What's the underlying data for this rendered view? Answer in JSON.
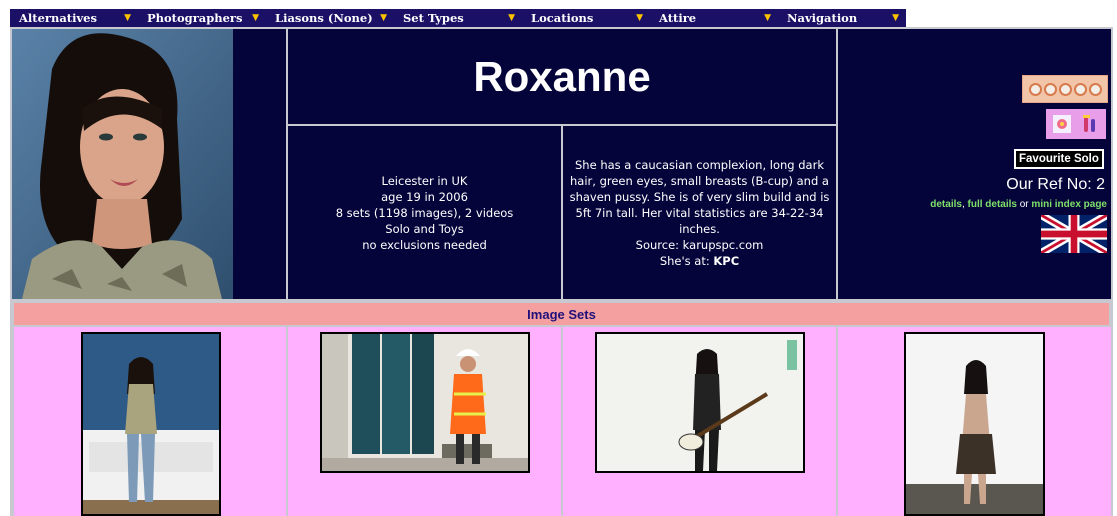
{
  "nav": [
    {
      "label": "Alternatives"
    },
    {
      "label": "Photographers"
    },
    {
      "label": "Liasons (None)"
    },
    {
      "label": "Set Types"
    },
    {
      "label": "Locations"
    },
    {
      "label": "Attire"
    },
    {
      "label": "Navigation"
    }
  ],
  "nav_arrow": "▼",
  "model": {
    "name": "Roxanne",
    "info": [
      "Leicester in UK",
      "age 19 in 2006",
      "8 sets (1198 images), 2 videos",
      "Solo and Toys",
      "no exclusions needed"
    ],
    "description": "She has a caucasian complexion, long dark hair, green eyes, small breasts (B-cup) and a shaven pussy. She is of very slim build and is 5ft 7in tall. Her vital statistics are 34-22-34 inches.",
    "source_label": "Source: karupspc.com",
    "shes_at_prefix": "She's at: ",
    "shes_at_site": "KPC"
  },
  "side": {
    "rating": 5,
    "favourite_label": "Favourite Solo",
    "ref_label": "Our Ref No: 2",
    "links": {
      "details": "details",
      "sep1": ", ",
      "full_details": "full details",
      "sep2": " or ",
      "mini_index": "mini index page"
    },
    "flag_icon": "uk-flag-icon",
    "solo_icon": "flower-icon",
    "toys_icon": "toys-icon"
  },
  "sets": {
    "header": "Image Sets"
  },
  "colors": {
    "nav_bg": "#1a1066",
    "panel_bg": "#05043a",
    "sets_header_bg": "#f4a0a0",
    "sets_bg": "#ffb0ff",
    "link": "#7fe06a",
    "arrow": "#ffc400"
  }
}
